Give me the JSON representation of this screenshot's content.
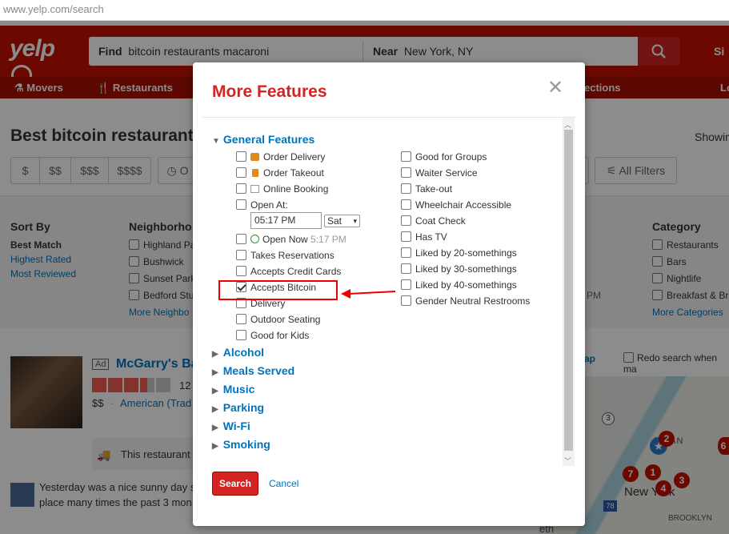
{
  "browser": {
    "url": "www.yelp.com/search"
  },
  "header": {
    "logo": "yelp",
    "find_label": "Find",
    "find_value": "bitcoin restaurants macaroni",
    "near_label": "Near",
    "near_value": "New York, NY",
    "signup": "Si"
  },
  "nav": {
    "items": [
      "Movers",
      "Restaurants",
      "ections",
      "Lo"
    ]
  },
  "results": {
    "heading": "Best bitcoin restaurant",
    "showing": "Showin",
    "price_pills": [
      "$",
      "$$",
      "$$$",
      "$$$$"
    ],
    "open_pill": "O",
    "all_filters": "All Filters",
    "sort_by": {
      "title": "Sort By",
      "items": [
        "Best Match",
        "Highest Rated",
        "Most Reviewed"
      ]
    },
    "neighborhoods": {
      "title": "Neighborho",
      "items": [
        "Highland Pa",
        "Bushwick",
        "Sunset Park",
        "Bedford Stu"
      ],
      "more": "More Neighbo"
    },
    "category": {
      "title": "Category",
      "items": [
        "Restaurants",
        "Bars",
        "Nightlife",
        "Breakfast & Br"
      ],
      "more": "More Categories"
    },
    "pm_text": "PM",
    "map_link": "ap",
    "redo_search": "Redo search when ma",
    "listing": {
      "ad": "Ad",
      "name": "McGarry's Ba",
      "reviews": "12",
      "price": "$$",
      "category": "American (Trad",
      "info": "This restaurant",
      "review_text_1": "Yesterday was a nice sunny day s",
      "review_text_2": "place many times the past 3 mon"
    },
    "map_labels": {
      "manhattan": "ATTAN",
      "new_york": "New York",
      "brooklyn": "BROOKLYN",
      "eth": "eth",
      "markers": [
        "7",
        "1",
        "2",
        "4",
        "3",
        "6"
      ],
      "road": "3",
      "road2": "78"
    }
  },
  "modal": {
    "title": "More Features",
    "general_features": "General Features",
    "left_options": [
      {
        "label": "Order Delivery",
        "checked": false,
        "icon": "truck-icon"
      },
      {
        "label": "Order Takeout",
        "checked": false,
        "icon": "bag-icon"
      },
      {
        "label": "Online Booking",
        "checked": false,
        "icon": "calendar-icon"
      },
      {
        "label": "Open At:",
        "checked": false
      },
      {
        "label": "Open Now",
        "suffix": "5:17 PM",
        "checked": false,
        "icon": "clock-icon"
      },
      {
        "label": "Takes Reservations",
        "checked": false
      },
      {
        "label": "Accepts Credit Cards",
        "checked": false
      },
      {
        "label": "Accepts Bitcoin",
        "checked": true
      },
      {
        "label": "Delivery",
        "checked": false
      },
      {
        "label": "Outdoor Seating",
        "checked": false
      },
      {
        "label": "Good for Kids",
        "checked": false
      }
    ],
    "right_options": [
      {
        "label": "Good for Groups",
        "checked": false
      },
      {
        "label": "Waiter Service",
        "checked": false
      },
      {
        "label": "Take-out",
        "checked": false
      },
      {
        "label": "Wheelchair Accessible",
        "checked": false
      },
      {
        "label": "Coat Check",
        "checked": false
      },
      {
        "label": "Has TV",
        "checked": false
      },
      {
        "label": "Liked by 20-somethings",
        "checked": false
      },
      {
        "label": "Liked by 30-somethings",
        "checked": false
      },
      {
        "label": "Liked by 40-somethings",
        "checked": false
      },
      {
        "label": "Gender Neutral Restrooms",
        "checked": false
      }
    ],
    "open_at_time": "05:17 PM",
    "open_at_day": "Sat",
    "sections": [
      "Alcohol",
      "Meals Served",
      "Music",
      "Parking",
      "Wi-Fi",
      "Smoking"
    ],
    "search_button": "Search",
    "cancel_link": "Cancel"
  },
  "colors": {
    "brand": "#c41200",
    "link": "#0073bb",
    "title": "#d32323",
    "highlight": "#e00000"
  }
}
